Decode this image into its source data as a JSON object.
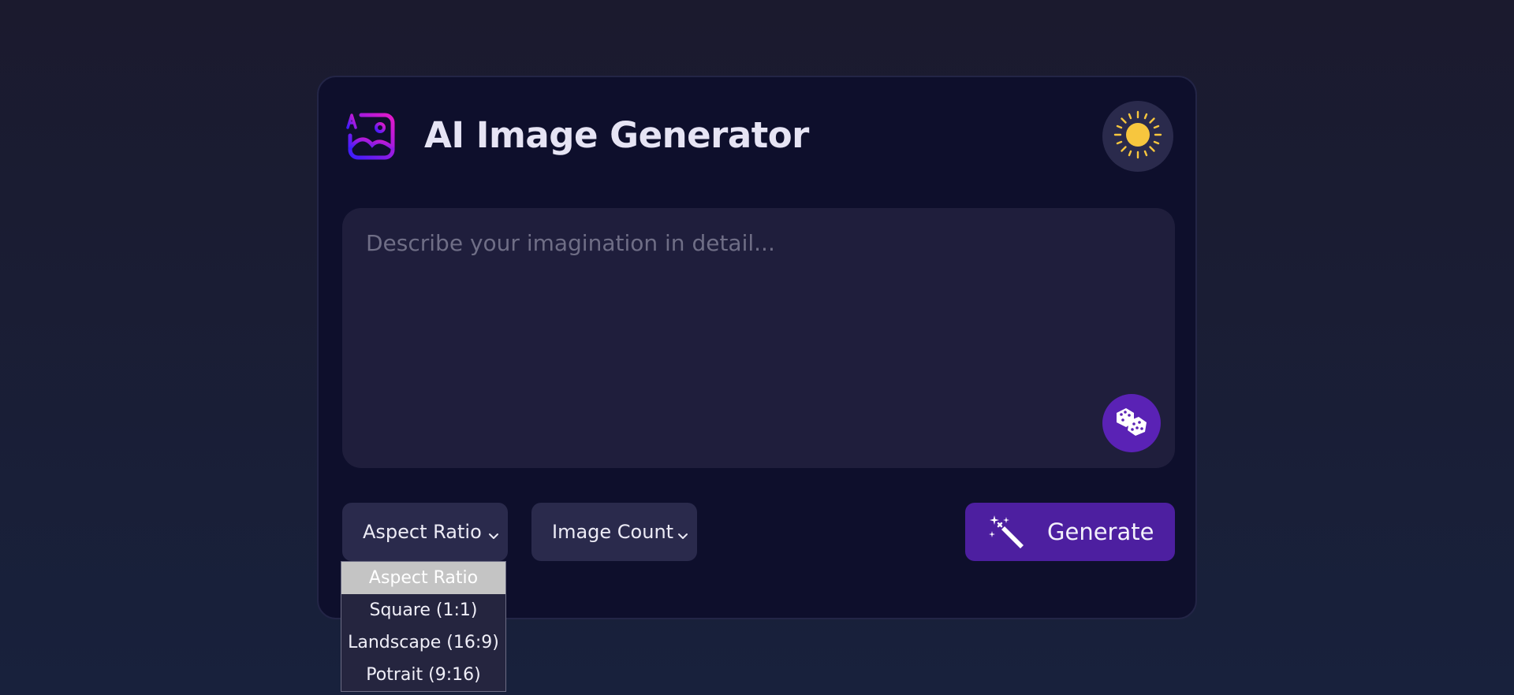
{
  "app": {
    "title": "AI Image Generator",
    "logo_icon": "ai-image-logo-icon",
    "theme_toggle_icon": "sun-icon"
  },
  "prompt": {
    "placeholder": "Describe your imagination in detail...",
    "value": "",
    "random_button_icon": "dice-icon"
  },
  "controls": {
    "aspect_ratio": {
      "selected_label": "Aspect Ratio",
      "options": [
        "Aspect Ratio",
        "Square (1:1)",
        "Landscape (16:9)",
        "Potrait (9:16)"
      ],
      "highlighted_index": 0
    },
    "image_count": {
      "selected_label": "Image Count"
    },
    "generate": {
      "label": "Generate",
      "icon": "magic-wand-icon"
    }
  },
  "colors": {
    "background": "#1b1a2e",
    "card": "#0e0f2c",
    "input": "#1f1e3c",
    "control": "#2a2a4c",
    "accent": "#5a22b5",
    "generate": "#4d1fa0",
    "sun": "#f7c63e",
    "logo_gradient_start": "#3a1dff",
    "logo_gradient_end": "#e619c9"
  }
}
